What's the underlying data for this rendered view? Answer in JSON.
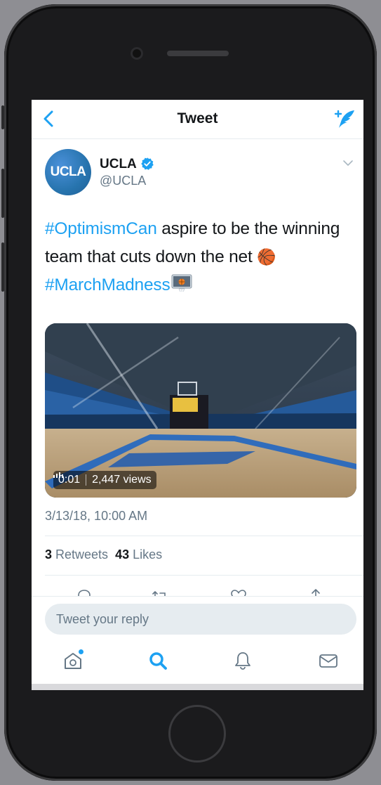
{
  "nav": {
    "title": "Tweet"
  },
  "tweet": {
    "author": {
      "name": "UCLA",
      "handle": "@UCLA",
      "avatar_text": "UCLA",
      "verified": true
    },
    "text_parts": [
      {
        "text": "#OptimismCan",
        "hashtag": true
      },
      {
        "text": " aspire to be the winning team that cuts down the net "
      },
      {
        "text": "🏀",
        "emoji": true
      },
      {
        "text": " "
      },
      {
        "text": "#MarchMadness",
        "hashtag": true
      }
    ],
    "media": {
      "duration": "0:01",
      "views": "2,447 views"
    },
    "timestamp": "3/13/18, 10:00 AM",
    "stats": {
      "retweets_count": "3",
      "retweets_label": " Retweets",
      "likes_count": "43",
      "likes_label": " Likes"
    }
  },
  "reply": {
    "placeholder": "Tweet your reply"
  },
  "colors": {
    "accent": "#1da1f2",
    "text_primary": "#14171a",
    "text_secondary": "#657786",
    "ucla_blue": "#2774ae"
  },
  "icons": {
    "nav_back": "chevron-left-icon",
    "nav_compose": "compose-icon",
    "actions": [
      "reply-icon",
      "retweet-icon",
      "like-icon",
      "share-icon"
    ],
    "tabs": [
      "home-icon",
      "search-icon",
      "notifications-icon",
      "messages-icon"
    ]
  }
}
